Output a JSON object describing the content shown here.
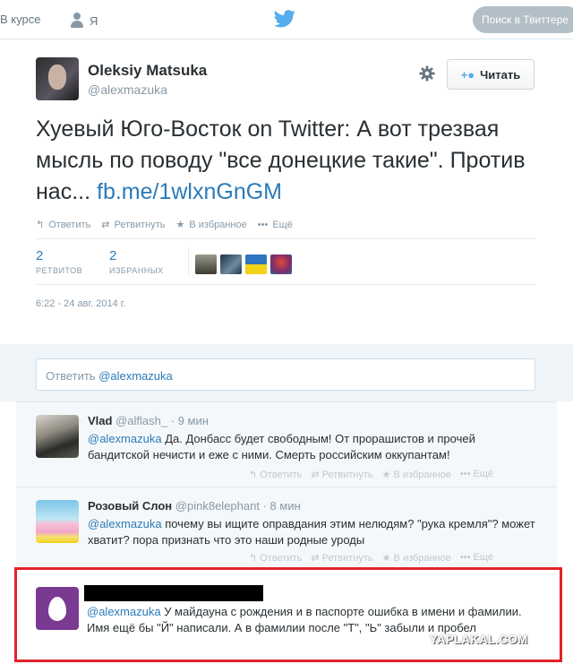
{
  "nav": {
    "home_label": "В курсе",
    "me_label": "Я",
    "search_placeholder": "Поиск в Твиттере"
  },
  "tweet": {
    "author_name": "Oleksiy Matsuka",
    "author_handle": "@alexmazuka",
    "follow_label": "Читать",
    "text_main": "Хуевый Юго-Восток on Twitter: А вот трезвая мысль по поводу \"все донецкие такие\". Против нас... ",
    "text_link": "fb.me/1wlxnGnGM",
    "actions": {
      "reply": "Ответить",
      "retweet": "Ретвитнуть",
      "favorite": "В избранное",
      "more": "Ещё"
    },
    "stats": {
      "retweets_count": "2",
      "retweets_label": "РЕТВИТОВ",
      "favorites_count": "2",
      "favorites_label": "ИЗБРАННЫХ"
    },
    "timestamp": "6:22 - 24 авг. 2014 г."
  },
  "reply_box": {
    "prefix": "Ответить ",
    "mention": "@alexmazuka"
  },
  "replies": [
    {
      "name": "Vlad",
      "handle": "@alflash_",
      "time": "9 мин",
      "mention": "@alexmazuka",
      "text": " Да. Донбасс будет свободным! От прорашистов и прочей бандитской нечисти и еже с ними. Смерть российским оккупантам!"
    },
    {
      "name": "Розовый Слон",
      "handle": "@pink8elephant",
      "time": "8 мин",
      "mention": "@alexmazuka",
      "text": " почему вы ищите оправдания этим нелюдям? \"рука кремля\"? может хватит? пора признать что это наши родные уроды"
    },
    {
      "mention": "@alexmazuka",
      "text": " У майдауна с рождения и в паспорте ошибка в имени и фамилии. Имя ещё бы \"Й\" написали. А в фамилии после \"Т\", \"Ь\" забыли и пробел"
    }
  ],
  "reply_actions": {
    "reply": "Ответить",
    "retweet": "Ретвитнуть",
    "favorite": "В избранное",
    "more": "Ещё"
  },
  "watermark": "YAPLAKAL.COM",
  "colors": {
    "accent": "#55acee",
    "link": "#2b7bb9",
    "highlight_border": "#e2232a",
    "egg_avatar_bg": "#7a3a92"
  }
}
